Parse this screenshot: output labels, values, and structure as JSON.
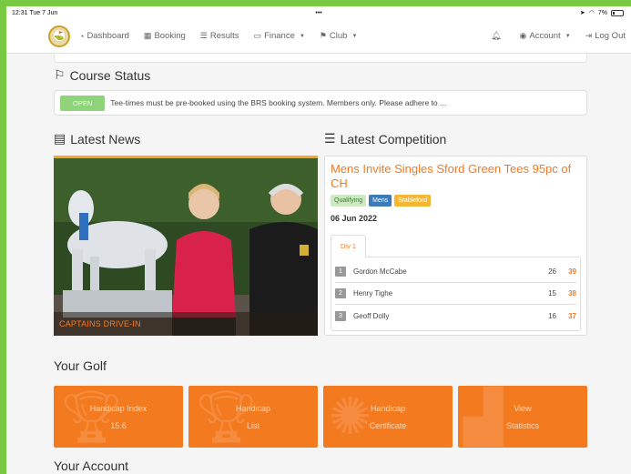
{
  "statusbar": {
    "time": "12:31",
    "date": "Tue 7 Jun",
    "dots": "•••",
    "battery": "7%"
  },
  "nav": {
    "logo_glyph": "⛳",
    "items": [
      {
        "label": "Dashboard",
        "icon": "tachometer-icon",
        "glyph": "◔"
      },
      {
        "label": "Booking",
        "icon": "calendar-icon",
        "glyph": "▦"
      },
      {
        "label": "Results",
        "icon": "list-icon",
        "glyph": "☰"
      },
      {
        "label": "Finance",
        "icon": "card-icon",
        "glyph": "▭"
      },
      {
        "label": "Club",
        "icon": "flag-icon",
        "glyph": "⚑"
      }
    ],
    "account": "Account",
    "logout": "Log Out"
  },
  "course_status": {
    "title": "Course Status",
    "badge": "OPEN",
    "message": "Tee-times must be pre-booked using the BRS booking system. Members only. Please adhere to ..."
  },
  "news": {
    "title": "Latest News",
    "caption": "CAPTAINS DRIVE-IN"
  },
  "competition": {
    "title": "Latest Competition",
    "name": "Mens Invite Singles Sford Green Tees 95pc of CH",
    "tags": [
      "Qualifying",
      "Mens",
      "Stableford"
    ],
    "date": "06 Jun 2022",
    "division_tab": "Div 1",
    "results": [
      {
        "pos": "1",
        "name": "Gordon McCabe",
        "handicap": "26",
        "points": "39"
      },
      {
        "pos": "2",
        "name": "Henry Tighe",
        "handicap": "15",
        "points": "38"
      },
      {
        "pos": "3",
        "name": "Geoff Dolly",
        "handicap": "16",
        "points": "37"
      }
    ]
  },
  "your_golf": {
    "title": "Your Golf",
    "tiles": [
      {
        "line1": "Handicap Index",
        "line2": "15.6"
      },
      {
        "line1": "Handicap",
        "line2": "List"
      },
      {
        "line1": "Handicap",
        "line2": "Certificate"
      },
      {
        "line1": "View",
        "line2": "Statistics"
      }
    ]
  },
  "your_account": {
    "title": "Your Account"
  },
  "colors": {
    "brand_orange": "#f47920",
    "frame_green": "#7ac943"
  }
}
